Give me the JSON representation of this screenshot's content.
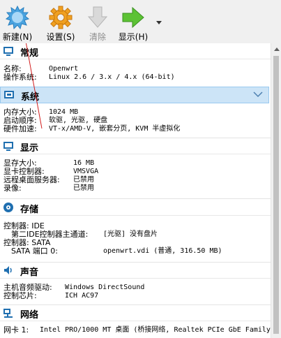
{
  "toolbar": {
    "new_label": "新建(N)",
    "settings_label": "设置(S)",
    "discard_label": "清除",
    "show_label": "显示(H)"
  },
  "general": {
    "title": "常规",
    "rows": [
      {
        "k": "名称:",
        "v": "Openwrt"
      },
      {
        "k": "操作系统:",
        "v": "Linux 2.6 / 3.x / 4.x (64-bit)"
      }
    ]
  },
  "system": {
    "title": "系统",
    "rows": [
      {
        "k": "内存大小:",
        "v": "1024 MB"
      },
      {
        "k": "启动顺序:",
        "v": "软驱, 光驱, 硬盘"
      },
      {
        "k": "硬件加速:",
        "v": "VT-x/AMD-V, 嵌套分页, KVM 半虚拟化"
      }
    ]
  },
  "display": {
    "title": "显示",
    "rows": [
      {
        "k": "显存大小:",
        "v": "16 MB"
      },
      {
        "k": "显卡控制器:",
        "v": "VMSVGA"
      },
      {
        "k": "远程桌面服务器:",
        "v": "已禁用"
      },
      {
        "k": "录像:",
        "v": "已禁用"
      }
    ]
  },
  "storage": {
    "title": "存储",
    "rows": [
      {
        "k": "控制器: IDE",
        "v": ""
      },
      {
        "k": "  第二IDE控制器主通道:",
        "v": "[光驱] 没有盘片"
      },
      {
        "k": "控制器: SATA",
        "v": ""
      },
      {
        "k": "  SATA 端口 0:",
        "v": "openwrt.vdi (普通, 316.50 MB)"
      }
    ]
  },
  "audio": {
    "title": "声音",
    "rows": [
      {
        "k": "主机音频驱动:",
        "v": "Windows DirectSound"
      },
      {
        "k": "控制芯片:",
        "v": "ICH AC97"
      }
    ]
  },
  "network": {
    "title": "网络",
    "rows": [
      {
        "k": "网卡 1:",
        "v": "Intel PRO/1000 MT 桌面 (桥接网络, Realtek PCIe GbE Family"
      }
    ]
  },
  "colors": {
    "selected_bg": "#cce4f7",
    "selected_border": "#99c9ef"
  }
}
